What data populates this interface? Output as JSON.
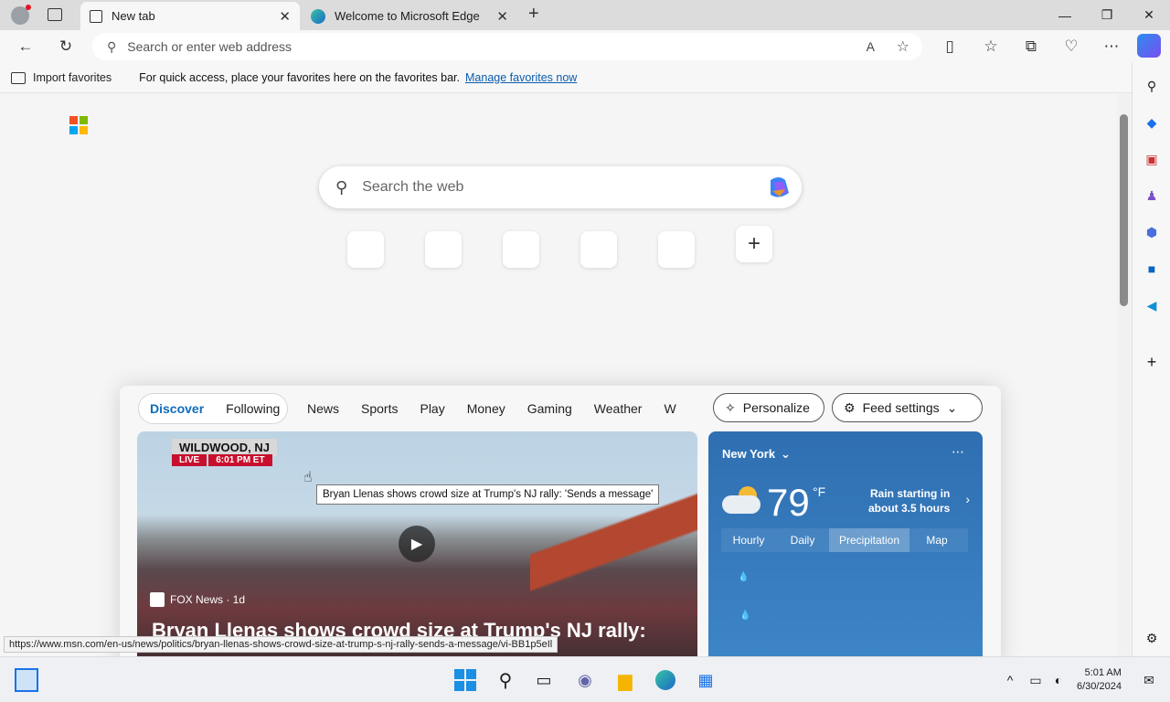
{
  "tabs": [
    {
      "label": "New tab"
    },
    {
      "label": "Welcome to Microsoft Edge"
    }
  ],
  "address_bar": {
    "placeholder": "Search or enter web address"
  },
  "favorites_bar": {
    "import_label": "Import favorites",
    "message": "For quick access, place your favorites here on the favorites bar.",
    "manage_link": "Manage favorites now"
  },
  "newtab": {
    "search_placeholder": "Search the web",
    "add_tile": "+"
  },
  "feed": {
    "pill": [
      "Discover",
      "Following"
    ],
    "categories": [
      "News",
      "Sports",
      "Play",
      "Money",
      "Gaming",
      "Weather",
      "W"
    ],
    "personalize": "Personalize",
    "feed_settings": "Feed settings",
    "hero": {
      "banner_location": "WILDWOOD, NJ",
      "banner_live": "LIVE",
      "banner_time": "6:01 PM ET",
      "source": "FOX News · 1d",
      "headline": "Bryan Llenas shows crowd size at Trump's NJ rally:"
    },
    "weather": {
      "city": "New York",
      "temp": "79",
      "unit": "°F",
      "rain": "Rain starting in",
      "rain2": "about 3.5 hours",
      "tabs": [
        "Hourly",
        "Daily",
        "Precipitation",
        "Map"
      ]
    }
  },
  "tooltip": "Bryan Llenas shows crowd size at Trump's NJ rally: 'Sends a message'",
  "status_url": "https://www.msn.com/en-us/news/politics/bryan-llenas-shows-crowd-size-at-trump-s-nj-rally-sends-a-message/vi-BB1p5eIl",
  "clock": {
    "time": "5:01 AM",
    "date": "6/30/2024"
  },
  "colors": {
    "accent": "#0f6cbd",
    "weather_bg": "#2f6fb1"
  }
}
